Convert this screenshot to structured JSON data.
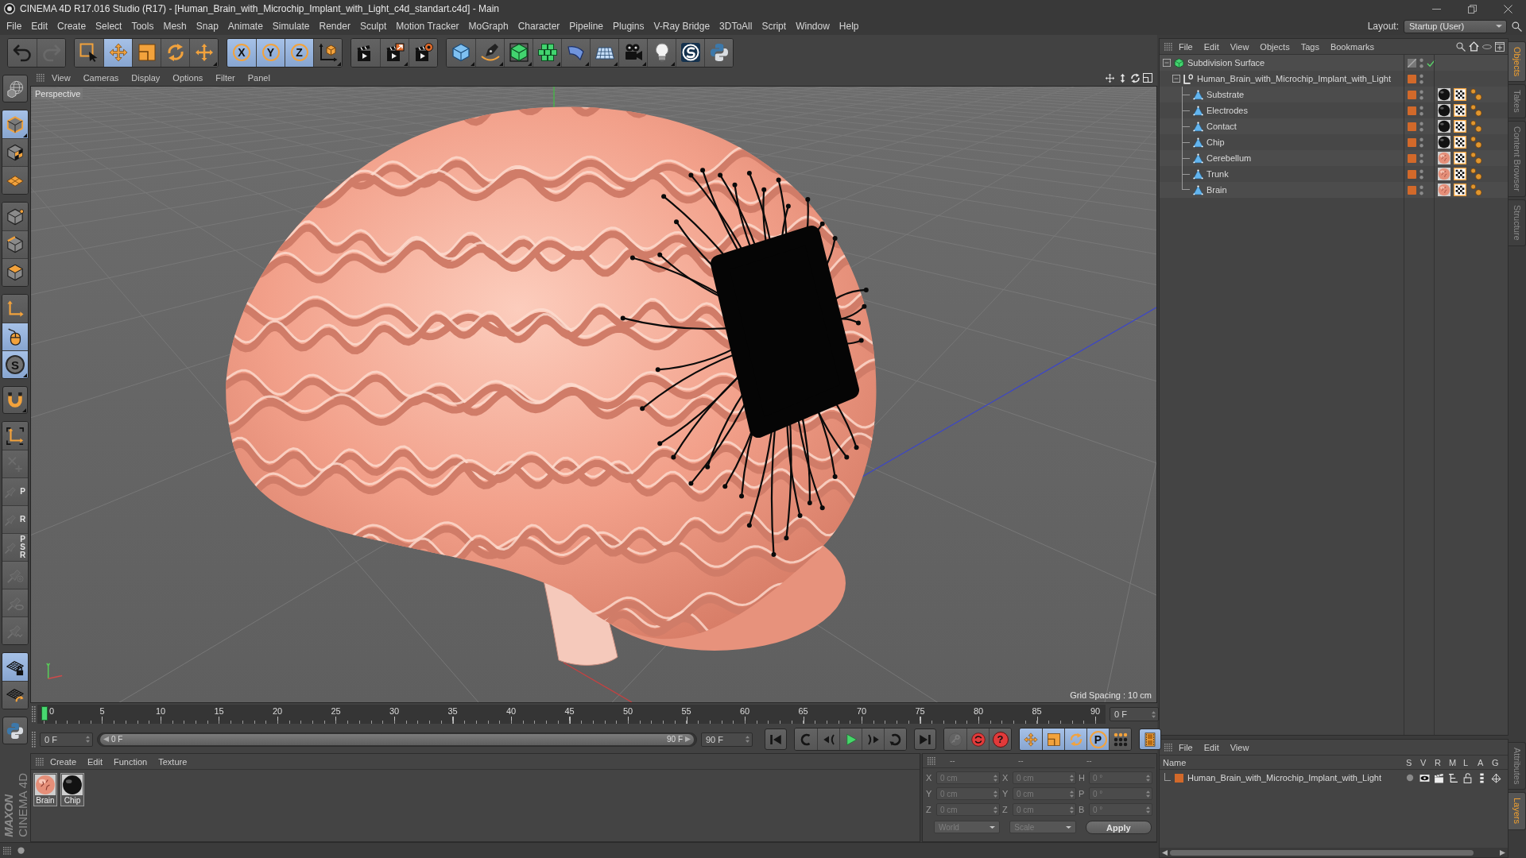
{
  "window": {
    "title": "CINEMA 4D R17.016 Studio (R17) - [Human_Brain_with_Microchip_Implant_with_Light_c4d_standart.c4d] - Main"
  },
  "menu_bar": {
    "items": [
      "File",
      "Edit",
      "Create",
      "Select",
      "Tools",
      "Mesh",
      "Snap",
      "Animate",
      "Simulate",
      "Render",
      "Sculpt",
      "Motion Tracker",
      "MoGraph",
      "Character",
      "Pipeline",
      "Plugins",
      "V-Ray Bridge",
      "3DToAll",
      "Script",
      "Window",
      "Help"
    ],
    "layout_label": "Layout:",
    "layout_value": "Startup (User)"
  },
  "toolbar": {
    "groups": [
      [
        {
          "kind": "undo",
          "disabled": false
        },
        {
          "kind": "redo",
          "disabled": true
        }
      ],
      [
        {
          "kind": "select",
          "selected": false,
          "menu": false
        },
        {
          "kind": "move",
          "selected": true,
          "menu": false
        },
        {
          "kind": "scale",
          "selected": false,
          "menu": false
        },
        {
          "kind": "rotate",
          "selected": false,
          "menu": false
        },
        {
          "kind": "transform",
          "selected": false,
          "menu": true
        }
      ],
      [
        {
          "kind": "axis",
          "letter": "X",
          "selected": true,
          "menu": false
        },
        {
          "kind": "axis",
          "letter": "Y",
          "selected": true,
          "menu": false
        },
        {
          "kind": "axis",
          "letter": "Z",
          "selected": true,
          "menu": false
        },
        {
          "kind": "coords",
          "selected": false,
          "menu": true
        }
      ],
      [
        {
          "kind": "render-view",
          "menu": false
        },
        {
          "kind": "render-viewer",
          "menu": true
        },
        {
          "kind": "render-settings",
          "menu": false
        }
      ],
      [
        {
          "kind": "cube",
          "menu": true
        },
        {
          "kind": "pen",
          "menu": true
        },
        {
          "kind": "subdivision",
          "menu": true
        },
        {
          "kind": "cloner",
          "menu": true
        },
        {
          "kind": "bend",
          "menu": true
        },
        {
          "kind": "floor",
          "menu": true
        },
        {
          "kind": "camera",
          "menu": true
        },
        {
          "kind": "light",
          "menu": true
        },
        {
          "kind": "vray",
          "menu": false
        },
        {
          "kind": "python",
          "menu": false
        }
      ]
    ]
  },
  "tool_strip": {
    "groups": [
      [
        {
          "kind": "globe"
        }
      ],
      [
        {
          "kind": "model",
          "selected": true,
          "menu": true
        },
        {
          "kind": "texture",
          "selected": false,
          "menu": false
        },
        {
          "kind": "workplane",
          "selected": false,
          "menu": false
        }
      ],
      [
        {
          "kind": "points",
          "selected": false
        },
        {
          "kind": "edges",
          "selected": false
        },
        {
          "kind": "polygons",
          "selected": false
        }
      ],
      [
        {
          "kind": "axis-mode",
          "selected": false,
          "menu": false
        },
        {
          "kind": "tweak",
          "selected": true,
          "menu": false
        },
        {
          "kind": "snap",
          "letter": "S",
          "selected": true,
          "menu": true
        }
      ],
      [
        {
          "kind": "magnet",
          "menu": true
        }
      ],
      [
        {
          "kind": "locks",
          "disabled": false
        },
        {
          "kind": "brush",
          "disabled": true
        },
        {
          "kind": "pin",
          "letter": "P",
          "disabled": true
        },
        {
          "kind": "pin",
          "letter": "R",
          "disabled": true
        },
        {
          "kind": "pin",
          "letter": "PSR",
          "disabled": true
        },
        {
          "kind": "pin-target",
          "disabled": true
        },
        {
          "kind": "pin-lasso",
          "disabled": true
        },
        {
          "kind": "pin-wave",
          "disabled": true
        }
      ],
      [
        {
          "kind": "gridlock",
          "selected": true
        },
        {
          "kind": "gridrotate",
          "selected": false
        }
      ],
      [
        {
          "kind": "python"
        }
      ]
    ]
  },
  "logo": {
    "brand": "MAXON",
    "product": "CINEMA 4D"
  },
  "viewport": {
    "menu": [
      "View",
      "Cameras",
      "Display",
      "Options",
      "Filter",
      "Panel"
    ],
    "camera": "Perspective",
    "grid_spacing": "Grid Spacing : 10 cm"
  },
  "timeline": {
    "ticks": [
      "0",
      "5",
      "10",
      "15",
      "20",
      "25",
      "30",
      "35",
      "40",
      "45",
      "50",
      "55",
      "60",
      "65",
      "70",
      "75",
      "80",
      "85",
      "90"
    ],
    "playhead": {
      "level": 0
    },
    "frame_field": "0 F"
  },
  "transport": {
    "current_field": "0 F",
    "range_slider": {
      "level": 1,
      "start": "0 F",
      "end": "90 F"
    },
    "end_field": "90 F",
    "groups": [
      [
        {
          "kind": "start"
        }
      ],
      [
        {
          "kind": "prevkey"
        },
        {
          "kind": "prevframe"
        },
        {
          "kind": "play"
        },
        {
          "kind": "nextframe"
        },
        {
          "kind": "nextkey"
        }
      ],
      [
        {
          "kind": "end"
        }
      ],
      [
        {
          "kind": "key",
          "disabled": true
        },
        {
          "kind": "record",
          "disabled": false
        },
        {
          "kind": "autokey",
          "letter": "?",
          "disabled": false
        }
      ],
      [
        {
          "kind": "move",
          "selected": true
        },
        {
          "kind": "scale",
          "selected": true
        },
        {
          "kind": "rotate",
          "selected": true
        },
        {
          "kind": "param",
          "letter": "P",
          "selected": true
        },
        {
          "kind": "dots",
          "selected": false
        }
      ],
      [
        {
          "kind": "film",
          "selected": true
        }
      ]
    ]
  },
  "materials": {
    "menu": [
      "Create",
      "Edit",
      "Function",
      "Texture"
    ],
    "items": [
      {
        "name": "Brain",
        "kind": "flesh"
      },
      {
        "name": "Chip",
        "kind": "dark"
      }
    ]
  },
  "coordinates": {
    "disabled": true,
    "headers": [
      "--",
      "--",
      "--"
    ],
    "rows": [
      [
        {
          "axis": "X",
          "value": "0 cm"
        },
        {
          "axis": "X",
          "value": "0 cm"
        },
        {
          "axis": "H",
          "value": "0 °"
        }
      ],
      [
        {
          "axis": "Y",
          "value": "0 cm"
        },
        {
          "axis": "Y",
          "value": "0 cm"
        },
        {
          "axis": "P",
          "value": "0 °"
        }
      ],
      [
        {
          "axis": "Z",
          "value": "0 cm"
        },
        {
          "axis": "Z",
          "value": "0 cm"
        },
        {
          "axis": "B",
          "value": "0 °"
        }
      ]
    ],
    "dropdowns": [
      "World",
      "Scale"
    ],
    "apply": "Apply"
  },
  "objects": {
    "menu": [
      "File",
      "Edit",
      "View",
      "Objects",
      "Tags",
      "Bookmarks"
    ],
    "tree": [
      {
        "name": "Subdivision Surface",
        "kind": "subdivision",
        "expanded": true,
        "selected": false,
        "on_layer": false,
        "enabled": true,
        "children": [
          {
            "name": "Human_Brain_with_Microchip_Implant_with_Light",
            "kind": "null",
            "expanded": true,
            "selected": false,
            "on_layer": true,
            "children": [
              {
                "name": "Substrate",
                "kind": "polygon",
                "selected": false,
                "on_layer": true,
                "tags": [
                  {
                    "kind": "dark-material"
                  },
                  {
                    "kind": "texture"
                  },
                  {
                    "kind": "phong"
                  }
                ]
              },
              {
                "name": "Electrodes",
                "kind": "polygon",
                "selected": false,
                "on_layer": true,
                "tags": [
                  {
                    "kind": "dark-material"
                  },
                  {
                    "kind": "texture"
                  },
                  {
                    "kind": "phong"
                  }
                ]
              },
              {
                "name": "Contact",
                "kind": "polygon",
                "selected": false,
                "on_layer": true,
                "tags": [
                  {
                    "kind": "dark-material"
                  },
                  {
                    "kind": "texture"
                  },
                  {
                    "kind": "phong"
                  }
                ]
              },
              {
                "name": "Chip",
                "kind": "polygon",
                "selected": false,
                "on_layer": true,
                "tags": [
                  {
                    "kind": "dark-material"
                  },
                  {
                    "kind": "texture"
                  },
                  {
                    "kind": "phong"
                  }
                ]
              },
              {
                "name": "Cerebellum",
                "kind": "polygon",
                "selected": false,
                "on_layer": true,
                "tags": [
                  {
                    "kind": "flesh-material"
                  },
                  {
                    "kind": "texture"
                  },
                  {
                    "kind": "phong"
                  }
                ]
              },
              {
                "name": "Trunk",
                "kind": "polygon",
                "selected": false,
                "on_layer": true,
                "tags": [
                  {
                    "kind": "flesh-material"
                  },
                  {
                    "kind": "texture"
                  },
                  {
                    "kind": "phong"
                  }
                ]
              },
              {
                "name": "Brain",
                "kind": "polygon",
                "selected": false,
                "on_layer": true,
                "tags": [
                  {
                    "kind": "flesh-material"
                  },
                  {
                    "kind": "texture"
                  },
                  {
                    "kind": "phong"
                  }
                ]
              }
            ]
          }
        ]
      }
    ]
  },
  "dock_tabs": {
    "upper": [
      {
        "label": "Objects",
        "selected": true
      },
      {
        "label": "Takes",
        "selected": false
      },
      {
        "label": "Content Browser",
        "selected": false
      },
      {
        "label": "Structure",
        "selected": false
      }
    ],
    "lower": [
      {
        "label": "Attributes",
        "selected": false
      },
      {
        "label": "Layers",
        "selected": true
      }
    ]
  },
  "layers": {
    "menu": [
      "File",
      "Edit",
      "View"
    ],
    "columns": [
      "Name",
      "S",
      "V",
      "R",
      "M",
      "L",
      "A",
      "G"
    ],
    "rows": [
      {
        "name": "Human_Brain_with_Microchip_Implant_with_Light",
        "color": "#d2692a"
      }
    ]
  }
}
